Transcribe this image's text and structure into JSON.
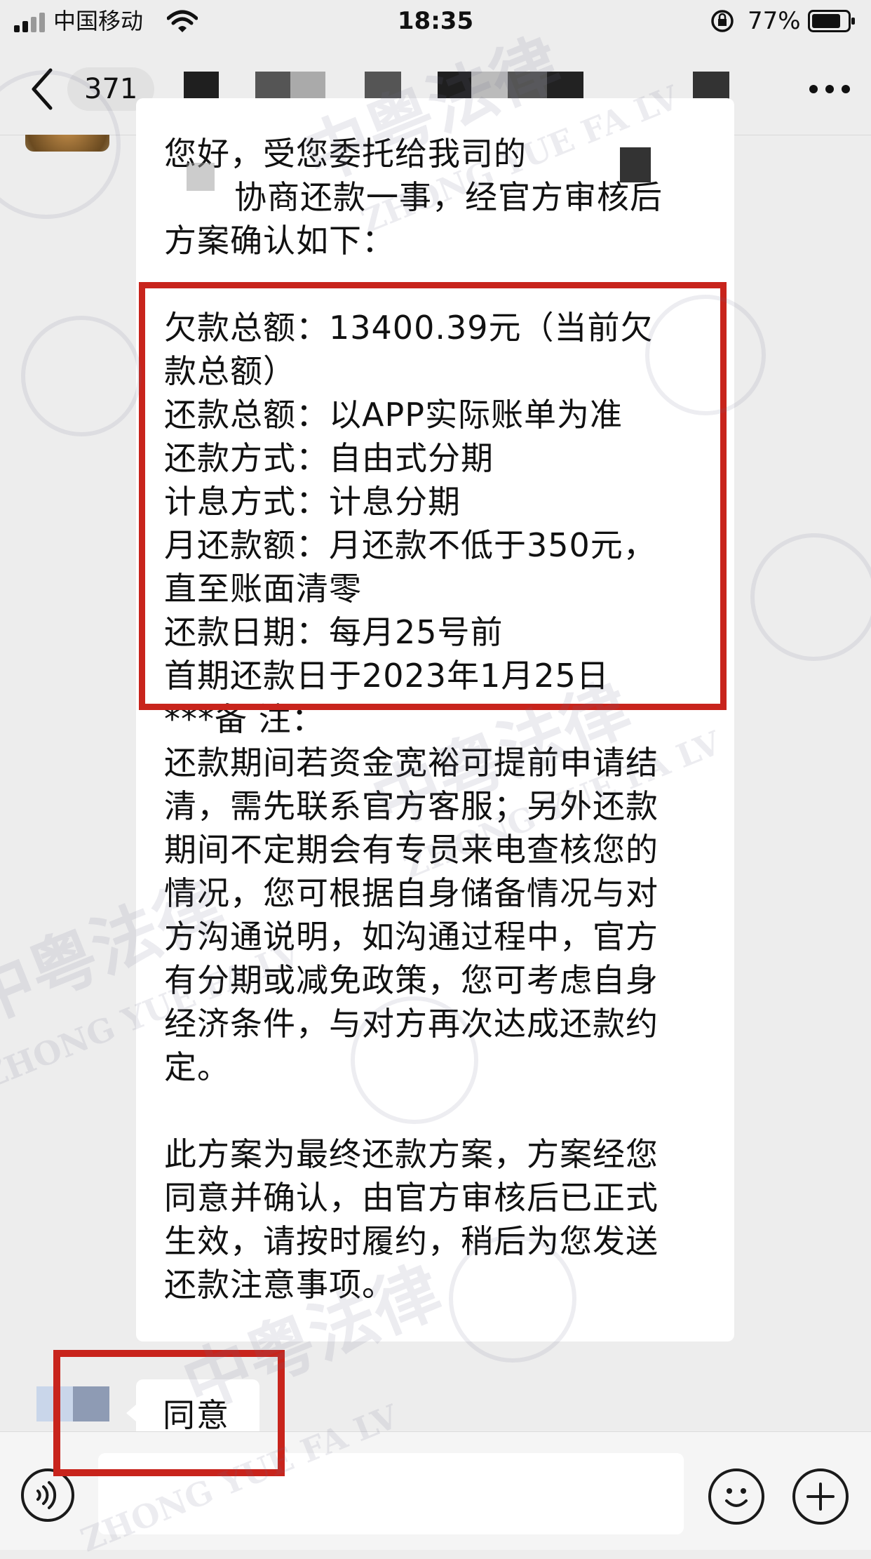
{
  "status_bar": {
    "carrier": "中国移动",
    "time": "18:35",
    "battery_percent": "77%",
    "icons": [
      "signal-icon",
      "wifi-icon",
      "rotation-lock-icon",
      "battery-icon"
    ]
  },
  "nav": {
    "unread_count": "371",
    "title_redacted": true,
    "icons": [
      "chevron-left-icon",
      "more-icon"
    ]
  },
  "message": {
    "lines": [
      "您好，受您委托给我司的",
      "协商还款一事，经官方审核后",
      "方案确认如下：",
      "欠款总额：13400.39元（当前欠",
      "款总额）",
      "还款总额：以APP实际账单为准",
      "还款方式：自由式分期",
      "计息方式：计息分期",
      "月还款额：月还款不低于350元，",
      "直至账面清零",
      "还款日期：每月25号前",
      "首期还款日于2023年1月25日",
      "***备 注：",
      "还款期间若资金宽裕可提前申请结",
      "清，需先联系官方客服；另外还款",
      "期间不定期会有专员来电查核您的",
      "情况，您可根据自身储备情况与对",
      "方沟通说明，如沟通过程中，官方",
      "有分期或减免政策，您可考虑自身",
      "经济条件，与对方再次达成还款约",
      "定。",
      "此方案为最终还款方案，方案经您",
      "同意并确认，由官方审核后已正式",
      "生效，请按时履约，稍后为您发送",
      "还款注意事项。"
    ]
  },
  "reply": {
    "text": "同意"
  },
  "input_bar": {
    "icons": [
      "voice-icon",
      "emoji-icon",
      "plus-icon"
    ]
  },
  "watermark": {
    "chinese": "中粤法律",
    "pinyin": "ZHONG YUE FA LV"
  },
  "colors": {
    "background": "#ededed",
    "bubble": "#ffffff",
    "highlight_box": "#c8241c"
  }
}
